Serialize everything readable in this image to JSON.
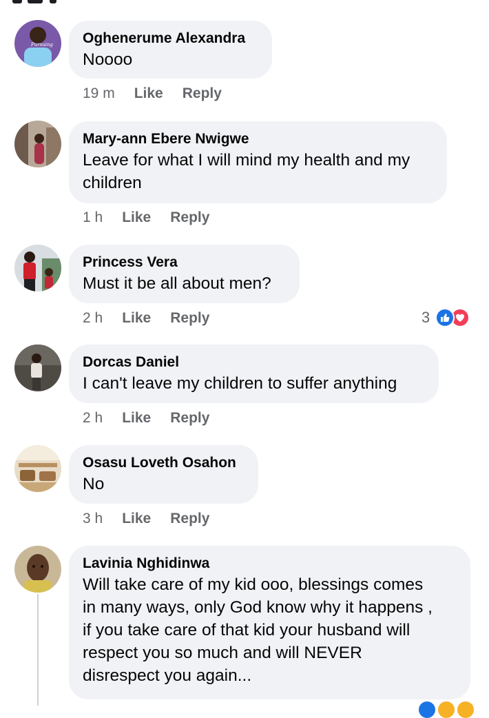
{
  "comments": [
    {
      "author": "Oghenerume Alexandra",
      "text": "Noooo",
      "time": "19 m",
      "like_label": "Like",
      "reply_label": "Reply"
    },
    {
      "author": "Mary-ann Ebere Nwigwe",
      "text": "Leave for what I will mind my health and my\nchildren",
      "time": "1 h",
      "like_label": "Like",
      "reply_label": "Reply"
    },
    {
      "author": "Princess Vera",
      "text": "Must it be all about men?",
      "time": "2 h",
      "like_label": "Like",
      "reply_label": "Reply",
      "reaction_count": "3",
      "reaction_icons": [
        "like-icon",
        "love-icon"
      ]
    },
    {
      "author": "Dorcas Daniel",
      "text": "I can't leave my children to suffer anything",
      "time": "2 h",
      "like_label": "Like",
      "reply_label": "Reply"
    },
    {
      "author": "Osasu Loveth Osahon",
      "text": "No",
      "time": "3 h",
      "like_label": "Like",
      "reply_label": "Reply"
    },
    {
      "author": "Lavinia Nghidinwa",
      "text": "Will take care of my kid ooo, blessings comes\nin many ways, only God know why it happens ,\nif you take care of that kid your husband will\nrespect you so much and will NEVER\ndisrespect you again...",
      "time": "",
      "like_label": "",
      "reply_label": ""
    }
  ],
  "colors": {
    "bubble": "#f0f2f5",
    "meta_text": "#65676b",
    "like_blue": "#1b74e4",
    "love_red": "#f33e58"
  }
}
